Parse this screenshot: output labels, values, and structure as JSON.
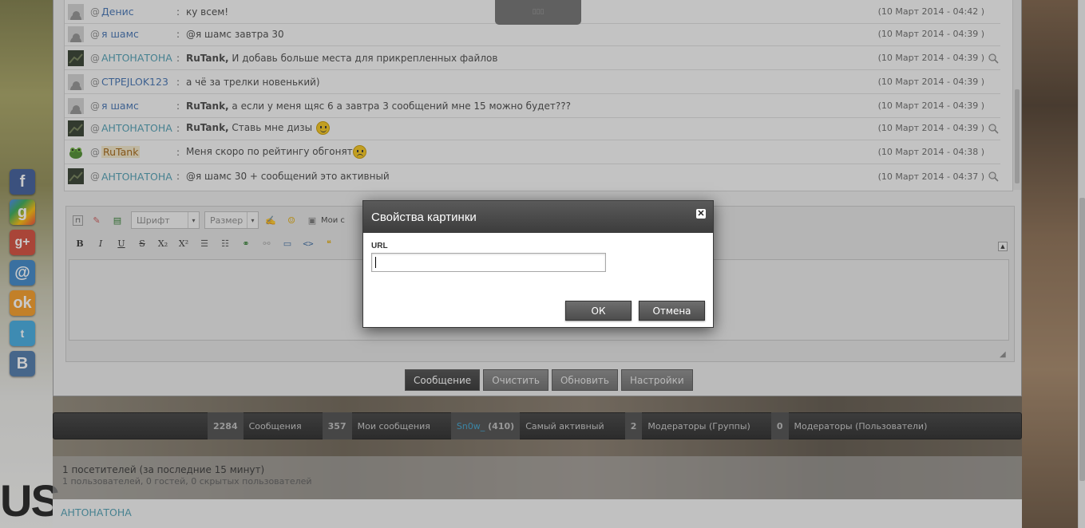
{
  "chat": {
    "messages": [
      {
        "nick": "Денис",
        "nick_style": "blue",
        "avatar": "default",
        "text_prefix": "",
        "text": "ку всем!",
        "time": "(10 Март 2014 - 04:42 )",
        "zoom": false
      },
      {
        "nick": "я шамс",
        "nick_style": "blue",
        "avatar": "default",
        "text_prefix": "",
        "text": "@я шамс завтра 30",
        "time": "(10 Март 2014 - 04:39 )",
        "zoom": false
      },
      {
        "nick": "АНТОНАТОНА",
        "nick_style": "teal",
        "avatar": "dark",
        "text_prefix": "RuTank,",
        "text": " И добавь больше места для прикрепленных файлов",
        "time": "(10 Март 2014 - 04:39 )",
        "zoom": true
      },
      {
        "nick": "CTPEJLOK123",
        "nick_style": "blue",
        "avatar": "default",
        "text_prefix": "",
        "text": "а чё за трелки новенький)",
        "time": "(10 Март 2014 - 04:39 )",
        "zoom": false
      },
      {
        "nick": "я шамс",
        "nick_style": "blue",
        "avatar": "default",
        "text_prefix": "RuTank,",
        "text": " а если у меня щяс 6 а завтра 3 сообщений мне 15 можно будет???",
        "time": "(10 Март 2014 - 04:39 )",
        "zoom": false
      },
      {
        "nick": "АНТОНАТОНА",
        "nick_style": "teal",
        "avatar": "dark",
        "text_prefix": "RuTank,",
        "text": " Ставь мне дизы",
        "time": "(10 Март 2014 - 04:39 )",
        "zoom": true,
        "smiley": "happy"
      },
      {
        "nick": "RuTank",
        "nick_style": "gold",
        "avatar": "frog",
        "text_prefix": "",
        "text": "Меня скоро по рейтингу обгонят",
        "time": "(10 Март 2014 - 04:38 )",
        "zoom": false,
        "smiley": "sad"
      },
      {
        "nick": "АНТОНАТОНА",
        "nick_style": "teal",
        "avatar": "dark",
        "text_prefix": "",
        "text": "@я шамс 30 + сообщений это активный",
        "time": "(10 Март 2014 - 04:37 )",
        "zoom": true
      }
    ]
  },
  "editor": {
    "font_placeholder": "Шрифт",
    "size_placeholder": "Размер",
    "toolbar_bold": "B",
    "toolbar_italic": "I",
    "toolbar_underline": "U",
    "toolbar_strike": "S",
    "toolbar_sub": "X₂",
    "toolbar_sup": "X²",
    "toolbar_my_label": "Мои с"
  },
  "actions": {
    "send": "Сообщение",
    "clear": "Очистить",
    "refresh": "Обновить",
    "settings": "Настройки"
  },
  "stats": [
    {
      "value": "2284",
      "label": "Сообщения"
    },
    {
      "value": "357",
      "label": "Мои сообщения"
    },
    {
      "value_name": "Sn0w_",
      "value": "(410)",
      "label": "Самый активный"
    },
    {
      "value": "2",
      "label": "Модераторы (Группы)"
    },
    {
      "value": "0",
      "label": "Модераторы (Пользователи)"
    }
  ],
  "visitors": {
    "title": "1 посетителей (за последние 15 минут)",
    "subtitle": "1 пользователей, 0 гостей, 0 скрытых пользователей",
    "online_user": "АНТОНАТОНА"
  },
  "dialog": {
    "title": "Свойства картинки",
    "url_label": "URL",
    "url_value": "",
    "ok": "ОК",
    "cancel": "Отмена"
  },
  "social": [
    "facebook-icon",
    "google-icon",
    "google-plus-icon",
    "mail-at-icon",
    "odnoklassniki-icon",
    "twitter-icon",
    "vkontakte-icon"
  ],
  "colors": {
    "nick_blue": "#3f6fb0",
    "nick_teal": "#4a9bb0",
    "nick_gold": "#a0600c",
    "dialog_header": "#3c3c3c"
  }
}
